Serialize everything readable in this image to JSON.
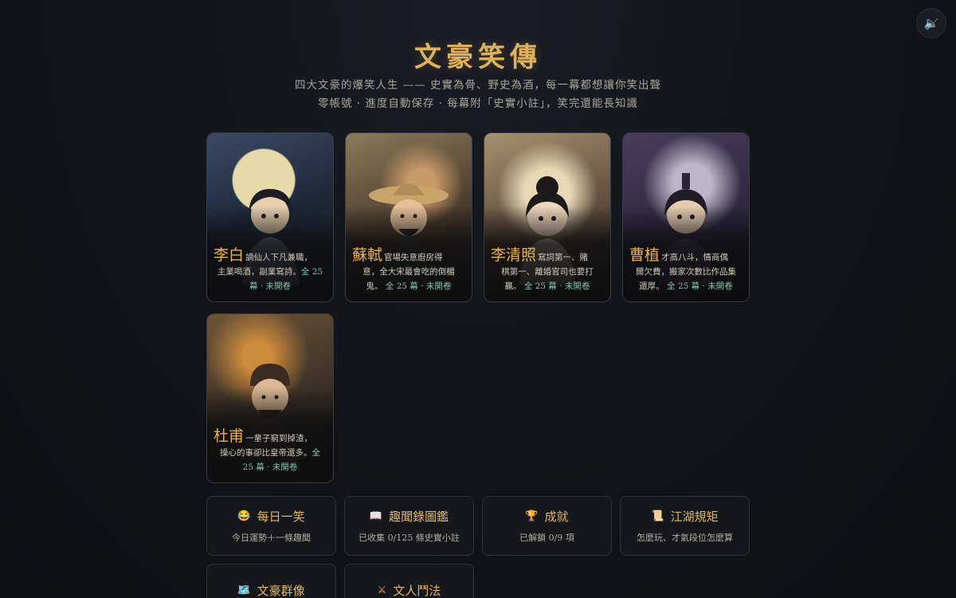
{
  "sound_button": {
    "icon": "muted-speaker-icon"
  },
  "header": {
    "title": "文豪笑傳",
    "subtitle_line1": "四大文豪的爆笑人生 —— 史實為骨、野史為酒，每一幕都想讓你笑出聲",
    "subtitle_line2": "零帳號 · 進度自動保存 · 每幕附「史實小註」，笑完還能長知識"
  },
  "cards": [
    {
      "name": "李白",
      "desc_a": "謫仙人下凡兼職，",
      "desc_b": "主業喝酒，副業寫詩。",
      "meta_a": "全 25",
      "meta_b": "幕 · 未開卷"
    },
    {
      "name": "蘇軾",
      "desc_a": "官場失意廚房得",
      "desc_b": "意，全大宋最會吃的倒楣",
      "desc_c": "鬼。",
      "meta": "全 25 幕 · 未開卷"
    },
    {
      "name": "李清照",
      "desc_a": "寫詞第一、賭",
      "desc_b": "棋第一、離婚官司也要打",
      "desc_c": "贏。",
      "meta": "全 25 幕 · 未開卷"
    },
    {
      "name": "曹植",
      "desc_a": "才高八斗，情商偶",
      "desc_b": "爾欠費，搬家次數比作品集",
      "desc_c": "還厚。",
      "meta": "全 25 幕 · 未開卷"
    },
    {
      "name": "杜甫",
      "desc_a": "一輩子窮到掉渣，",
      "desc_b": "操心的事卻比皇帝還多。",
      "meta_a": "全",
      "meta_b": "25 幕 · 未開卷"
    }
  ],
  "menu": [
    {
      "icon": "😂",
      "label": "每日一笑",
      "desc": "今日運勢＋一條趣聞"
    },
    {
      "icon": "📖",
      "label": "趣聞錄圖鑑",
      "desc": "已收集 0/125 條史實小註"
    },
    {
      "icon": "🏆",
      "label": "成就",
      "desc": "已解鎖 0/9 項"
    },
    {
      "icon": "📜",
      "label": "江湖規矩",
      "desc": "怎麼玩、才氣段位怎麼算"
    },
    {
      "icon": "🗺️",
      "label": "文豪群像",
      "desc": ""
    },
    {
      "icon": "⚔",
      "label": "文人鬥法",
      "desc": ""
    }
  ]
}
